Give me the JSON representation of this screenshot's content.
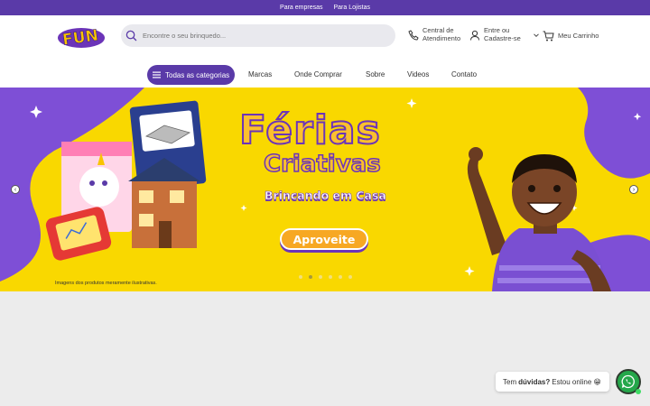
{
  "topbar": {
    "links": [
      "Para empresas",
      "Para Lojistas"
    ]
  },
  "header": {
    "logo_text": "FUN",
    "search_placeholder": "Encontre o seu brinquedo...",
    "support": {
      "line1": "Central de",
      "line2": "Atendimento"
    },
    "account": {
      "line1": "Entre ou",
      "line2": "Cadastre-se"
    },
    "cart": "Meu Carrinho"
  },
  "nav": {
    "categories_label": "Todas as categorias",
    "items": [
      "Marcas",
      "Onde Comprar",
      "Sobre",
      "Videos",
      "Contato"
    ]
  },
  "banner": {
    "title_line1": "Férias",
    "title_line2": "Criativas",
    "subtitle": "Brincando em Casa",
    "cta": "Aproveite",
    "disclaimer": "Imagens dos produtos meramente ilustrativas.",
    "prev": "‹",
    "next": "›",
    "slides_total": 6,
    "active_slide": 2,
    "colors": {
      "background": "#f9d800",
      "accent": "#6b34b8",
      "cta": "#f7a823"
    }
  },
  "chat": {
    "prefix": "Tem",
    "strong": "dúvidas?",
    "suffix": "Estou online 😁"
  },
  "icons": {
    "search": "search-icon",
    "support": "phone-headset-icon",
    "account": "user-icon",
    "cart": "cart-icon",
    "menu": "hamburger-icon",
    "whatsapp": "whatsapp-icon"
  },
  "brand_color": "#5a3aa8"
}
